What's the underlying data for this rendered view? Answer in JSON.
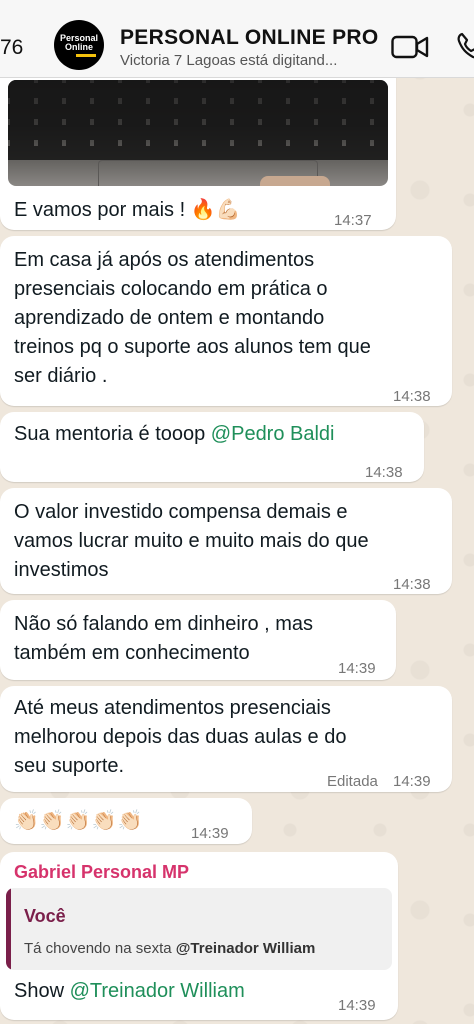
{
  "header": {
    "back_count": "76",
    "avatar_text_line1": "Personal",
    "avatar_text_line2": "Online",
    "contact_name": "PERSONAL ONLINE PRO",
    "status": "Victoria 7 Lagoas  está digitand..."
  },
  "messages": [
    {
      "id": "m1",
      "type": "photo",
      "text": "E vamos por mais ! 🔥💪🏻",
      "time": "14:37"
    },
    {
      "id": "m2",
      "lines": [
        "Em casa já após os atendimentos",
        "presenciais colocando em prática o",
        "aprendizado de ontem e montando",
        "treinos pq o suporte aos alunos tem que",
        "ser diário ."
      ],
      "time": "14:38"
    },
    {
      "id": "m3",
      "text_prefix": "Sua mentoria é tooop ",
      "mention": "@Pedro Baldi",
      "time": "14:38"
    },
    {
      "id": "m4",
      "lines": [
        "O valor investido compensa demais e",
        "vamos lucrar muito e muito mais do que",
        "investimos"
      ],
      "time": "14:38"
    },
    {
      "id": "m5",
      "lines": [
        "Não só falando em dinheiro , mas",
        "também em conhecimento"
      ],
      "time": "14:39"
    },
    {
      "id": "m6",
      "lines": [
        "Até meus atendimentos presenciais",
        "melhorou depois das duas aulas e  do",
        "seu suporte."
      ],
      "edited": "Editada",
      "time": "14:39"
    },
    {
      "id": "m7",
      "text": "👏🏻👏🏻👏🏻👏🏻👏🏻",
      "time": "14:39"
    },
    {
      "id": "m8",
      "sender": "Gabriel Personal MP",
      "reply_author": "Você",
      "reply_text_prefix": "Tá chovendo na sexta ",
      "reply_mention": "@Treinador William",
      "text_prefix": "Show ",
      "mention": "@Treinador William",
      "time": "14:39"
    }
  ],
  "colors": {
    "mention": "#1f8f5a",
    "sender_name": "#d6336c",
    "reply_bar": "#7a1f4a",
    "background": "#efe7dc"
  },
  "icons": [
    "video-call-icon",
    "phone-call-icon"
  ]
}
